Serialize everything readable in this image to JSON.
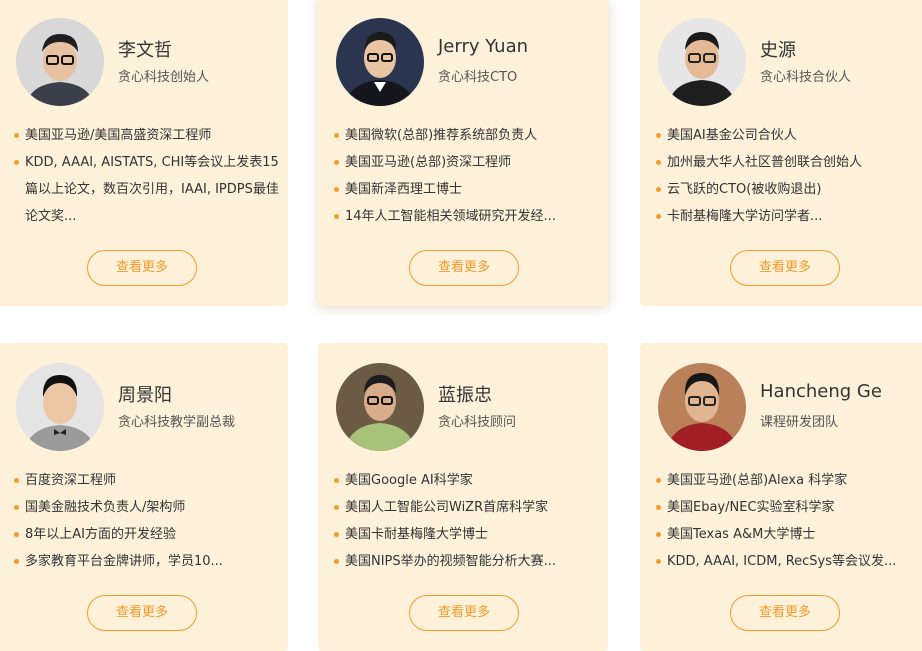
{
  "colors": {
    "card_bg": "#fdf1da",
    "accent": "#f39b2c",
    "text": "#333333"
  },
  "more_label": "查看更多",
  "cards": [
    {
      "name": "李文哲",
      "title": "贪心科技创始人",
      "items": [
        "美国亚马逊/美国高盛资深工程师",
        "KDD, AAAI, AISTATS, CHI等会议上发表15篇以上论文，数百次引用，IAAI, IPDPS最佳论文奖..."
      ]
    },
    {
      "name": "Jerry Yuan",
      "title": "贪心科技CTO",
      "items": [
        "美国微软(总部)推荐系统部负责人",
        "美国亚马逊(总部)资深工程师",
        "美国新泽西理工博士",
        "14年人工智能相关领域研究开发经..."
      ]
    },
    {
      "name": "史源",
      "title": "贪心科技合伙人",
      "items": [
        "美国AI基金公司合伙人",
        "加州最大华人社区普创联合创始人",
        "云飞跃的CTO(被收购退出)",
        "卡耐基梅隆大学访问学者..."
      ]
    },
    {
      "name": "周景阳",
      "title": "贪心科技教学副总裁",
      "items": [
        "百度资深工程师",
        "国美金融技术负责人/架构师",
        "8年以上AI方面的开发经验",
        "多家教育平台金牌讲师，学员10..."
      ]
    },
    {
      "name": "蓝振忠",
      "title": "贪心科技顾问",
      "items": [
        "美国Google AI科学家",
        "美国人工智能公司WiZR首席科学家",
        "美国卡耐基梅隆大学博士",
        "美国NIPS举办的视频智能分析大赛..."
      ]
    },
    {
      "name": "Hancheng Ge",
      "title": "课程研发团队",
      "items": [
        "美国亚马逊(总部)Alexa 科学家",
        "美国Ebay/NEC实验室科学家",
        "美国Texas A&M大学博士",
        "KDD, AAAI, ICDM, RecSys等会议发..."
      ]
    }
  ]
}
